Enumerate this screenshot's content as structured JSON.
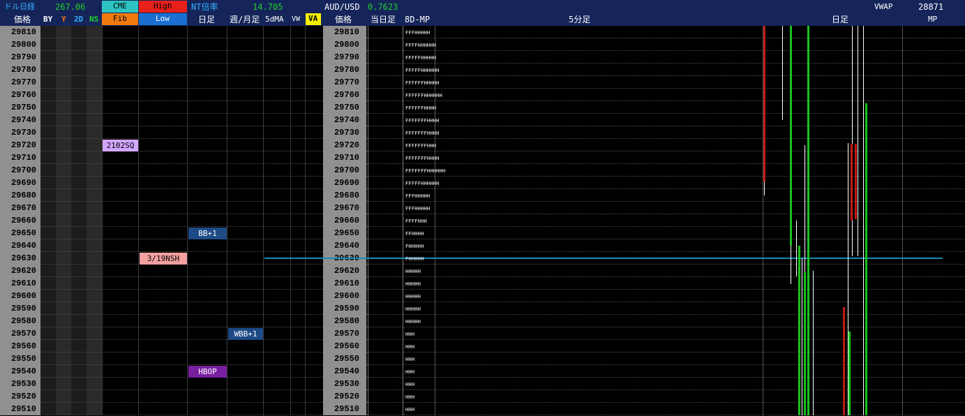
{
  "header": {
    "row1": {
      "dollar_nikkei_label": "ドル日経",
      "dollar_nikkei_value": "267.06",
      "cme_label": "CME",
      "high_label": "High",
      "nt_label": "NT倍率",
      "nt_value": "14.705",
      "audusd_label": "AUD/USD",
      "audusd_value": "0.7623",
      "vwap_label": "VWAP",
      "vwap_value": "28871"
    },
    "row2": {
      "price_label": "価格",
      "by_label": "BY",
      "y_label": "Y",
      "twod_label": "2D",
      "ns_label": "NS",
      "fib_label": "Fib",
      "low_label": "Low",
      "daily_label": "日足",
      "weekmonth_label": "週/月足",
      "fivedma_label": "5dMA",
      "vw_label": "VW",
      "va_label": "VA",
      "price2_label": "価格",
      "today_label": "当日足",
      "eightd_label": "8D-MP",
      "five_min_label": "5分足",
      "daily2_label": "日足",
      "mp_label": "MP"
    }
  },
  "prices": [
    "29810",
    "29800",
    "29790",
    "29780",
    "29770",
    "29760",
    "29750",
    "29740",
    "29730",
    "29720",
    "29710",
    "29700",
    "29690",
    "29680",
    "29670",
    "29660",
    "29650",
    "29640",
    "29630",
    "29620",
    "29610",
    "29600",
    "29590",
    "29580",
    "29570",
    "29560",
    "29550",
    "29540",
    "29530",
    "29520",
    "29510"
  ],
  "tags": {
    "sq": "2102SQ",
    "bb": "BB+1",
    "nsh": "3/19NSH",
    "wbb": "WBB+1",
    "hbop": "HBOP"
  },
  "market_profile": [
    "FFFHHHHH",
    "FFFFHHHHHH",
    "FFFFFHHHHH",
    "FFFFFHHHHHH",
    "FFFFFFHHHHH",
    "FFFFFFHHHHHH",
    "FFFFFFHHHH",
    "FFFFFFFHHHH",
    "FFFFFFFHHHH",
    "FFFFFFFHHH",
    "FFFFFFFHHHH",
    "FFFFFFFHHHHHH",
    "FFFFFHHHHHH",
    "FFFHHHHH",
    "FFFHHHHH",
    "FFFFHHH",
    "FFHHHH",
    "FHHHHH",
    "FHHHHH",
    "HHHHH",
    "HHHHH",
    "HHHHH",
    "HHHHH",
    "HHHHH",
    "HHH",
    "HHH",
    "HHH",
    "HHH",
    "HHH",
    "HHH",
    "HHH"
  ],
  "colors": {
    "header_bg": "#15255a",
    "cme": "#2ec4c4",
    "high": "#e8201a",
    "fib": "#f07a10",
    "low": "#1a6fd0",
    "green_value": "#22d02a",
    "va_bg": "#f5f000",
    "price_col": "#909090",
    "red_bar": "#c11a12",
    "green_bar": "#19c21d",
    "blue_line": "#1a8ab8"
  }
}
